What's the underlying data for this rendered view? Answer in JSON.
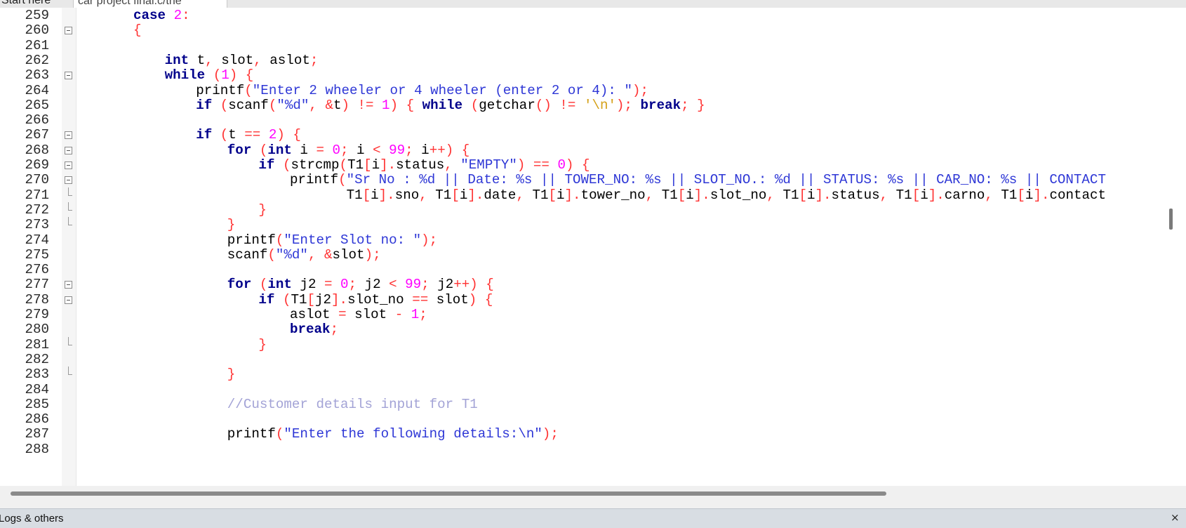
{
  "tabs": [
    {
      "label": "Start here"
    },
    {
      "label": "car project final.c/the"
    }
  ],
  "status_panel": {
    "label": "Logs & others",
    "close_glyph": "×"
  },
  "icons": {
    "fold": "fold-minus-icon",
    "close": "close-icon"
  },
  "colors": {
    "keyword": "#00008b",
    "string": "#2e37d6",
    "number": "#ff00ff",
    "operator": "#ff3333",
    "comment": "#a3a3d6",
    "char": "#d4a017"
  },
  "lines": [
    {
      "n": "259",
      "tokens": [
        {
          "t": "case",
          "c": "k"
        },
        {
          "t": " ",
          "c": "p"
        },
        {
          "t": "2",
          "c": "n"
        },
        {
          "t": ":",
          "c": "o"
        }
      ],
      "indent": 0
    },
    {
      "n": "260",
      "tokens": [
        {
          "t": "{",
          "c": "o"
        }
      ],
      "indent": 0,
      "fold": "open"
    },
    {
      "n": "261",
      "tokens": [],
      "indent": 0
    },
    {
      "n": "262",
      "tokens": [
        {
          "t": "int",
          "c": "k"
        },
        {
          "t": " t",
          "c": "p"
        },
        {
          "t": ",",
          "c": "o"
        },
        {
          "t": " slot",
          "c": "p"
        },
        {
          "t": ",",
          "c": "o"
        },
        {
          "t": " aslot",
          "c": "p"
        },
        {
          "t": ";",
          "c": "o"
        }
      ],
      "indent": 1
    },
    {
      "n": "263",
      "tokens": [
        {
          "t": "while",
          "c": "k"
        },
        {
          "t": " ",
          "c": "p"
        },
        {
          "t": "(",
          "c": "o"
        },
        {
          "t": "1",
          "c": "n"
        },
        {
          "t": ")",
          "c": "o"
        },
        {
          "t": " ",
          "c": "p"
        },
        {
          "t": "{",
          "c": "o"
        }
      ],
      "indent": 1,
      "fold": "open"
    },
    {
      "n": "264",
      "tokens": [
        {
          "t": "printf",
          "c": "p"
        },
        {
          "t": "(",
          "c": "o"
        },
        {
          "t": "\"Enter 2 wheeler or 4 wheeler (enter 2 or 4): \"",
          "c": "s"
        },
        {
          "t": ");",
          "c": "o"
        }
      ],
      "indent": 2
    },
    {
      "n": "265",
      "tokens": [
        {
          "t": "if",
          "c": "k"
        },
        {
          "t": " ",
          "c": "p"
        },
        {
          "t": "(",
          "c": "o"
        },
        {
          "t": "scanf",
          "c": "p"
        },
        {
          "t": "(",
          "c": "o"
        },
        {
          "t": "\"%d\"",
          "c": "s"
        },
        {
          "t": ",",
          "c": "o"
        },
        {
          "t": " ",
          "c": "p"
        },
        {
          "t": "&",
          "c": "o"
        },
        {
          "t": "t",
          "c": "p"
        },
        {
          "t": ")",
          "c": "o"
        },
        {
          "t": " ",
          "c": "p"
        },
        {
          "t": "!=",
          "c": "o"
        },
        {
          "t": " ",
          "c": "p"
        },
        {
          "t": "1",
          "c": "n"
        },
        {
          "t": ")",
          "c": "o"
        },
        {
          "t": " ",
          "c": "p"
        },
        {
          "t": "{",
          "c": "o"
        },
        {
          "t": " ",
          "c": "p"
        },
        {
          "t": "while",
          "c": "k"
        },
        {
          "t": " ",
          "c": "p"
        },
        {
          "t": "(",
          "c": "o"
        },
        {
          "t": "getchar",
          "c": "p"
        },
        {
          "t": "()",
          "c": "o"
        },
        {
          "t": " ",
          "c": "p"
        },
        {
          "t": "!=",
          "c": "o"
        },
        {
          "t": " ",
          "c": "p"
        },
        {
          "t": "'\\n'",
          "c": "ch"
        },
        {
          "t": ");",
          "c": "o"
        },
        {
          "t": " ",
          "c": "p"
        },
        {
          "t": "break",
          "c": "k"
        },
        {
          "t": ";",
          "c": "o"
        },
        {
          "t": " ",
          "c": "p"
        },
        {
          "t": "}",
          "c": "o"
        }
      ],
      "indent": 2
    },
    {
      "n": "266",
      "tokens": [],
      "indent": 0
    },
    {
      "n": "267",
      "tokens": [
        {
          "t": "if",
          "c": "k"
        },
        {
          "t": " ",
          "c": "p"
        },
        {
          "t": "(",
          "c": "o"
        },
        {
          "t": "t",
          "c": "p"
        },
        {
          "t": " ",
          "c": "p"
        },
        {
          "t": "==",
          "c": "o"
        },
        {
          "t": " ",
          "c": "p"
        },
        {
          "t": "2",
          "c": "n"
        },
        {
          "t": ")",
          "c": "o"
        },
        {
          "t": " ",
          "c": "p"
        },
        {
          "t": "{",
          "c": "o"
        }
      ],
      "indent": 2,
      "fold": "open"
    },
    {
      "n": "268",
      "tokens": [
        {
          "t": "for",
          "c": "k"
        },
        {
          "t": " ",
          "c": "p"
        },
        {
          "t": "(",
          "c": "o"
        },
        {
          "t": "int",
          "c": "k"
        },
        {
          "t": " i ",
          "c": "p"
        },
        {
          "t": "=",
          "c": "o"
        },
        {
          "t": " ",
          "c": "p"
        },
        {
          "t": "0",
          "c": "n"
        },
        {
          "t": ";",
          "c": "o"
        },
        {
          "t": " i ",
          "c": "p"
        },
        {
          "t": "<",
          "c": "o"
        },
        {
          "t": " ",
          "c": "p"
        },
        {
          "t": "99",
          "c": "n"
        },
        {
          "t": ";",
          "c": "o"
        },
        {
          "t": " i",
          "c": "p"
        },
        {
          "t": "++)",
          "c": "o"
        },
        {
          "t": " ",
          "c": "p"
        },
        {
          "t": "{",
          "c": "o"
        }
      ],
      "indent": 3,
      "fold": "open"
    },
    {
      "n": "269",
      "tokens": [
        {
          "t": "if",
          "c": "k"
        },
        {
          "t": " ",
          "c": "p"
        },
        {
          "t": "(",
          "c": "o"
        },
        {
          "t": "strcmp",
          "c": "p"
        },
        {
          "t": "(",
          "c": "o"
        },
        {
          "t": "T1",
          "c": "p"
        },
        {
          "t": "[",
          "c": "o"
        },
        {
          "t": "i",
          "c": "p"
        },
        {
          "t": "].",
          "c": "o"
        },
        {
          "t": "status",
          "c": "p"
        },
        {
          "t": ",",
          "c": "o"
        },
        {
          "t": " ",
          "c": "p"
        },
        {
          "t": "\"EMPTY\"",
          "c": "s"
        },
        {
          "t": ")",
          "c": "o"
        },
        {
          "t": " ",
          "c": "p"
        },
        {
          "t": "==",
          "c": "o"
        },
        {
          "t": " ",
          "c": "p"
        },
        {
          "t": "0",
          "c": "n"
        },
        {
          "t": ")",
          "c": "o"
        },
        {
          "t": " ",
          "c": "p"
        },
        {
          "t": "{",
          "c": "o"
        }
      ],
      "indent": 4,
      "fold": "open"
    },
    {
      "n": "270",
      "tokens": [
        {
          "t": "printf",
          "c": "p"
        },
        {
          "t": "(",
          "c": "o"
        },
        {
          "t": "\"Sr No : %d || Date: %s || TOWER_NO: %s || SLOT_NO.: %d || STATUS: %s || CAR_NO: %s || CONTACT",
          "c": "s"
        }
      ],
      "indent": 5,
      "fold": "open"
    },
    {
      "n": "271",
      "tokens": [
        {
          "t": "       T1",
          "c": "p"
        },
        {
          "t": "[",
          "c": "o"
        },
        {
          "t": "i",
          "c": "p"
        },
        {
          "t": "].",
          "c": "o"
        },
        {
          "t": "sno",
          "c": "p"
        },
        {
          "t": ",",
          "c": "o"
        },
        {
          "t": " T1",
          "c": "p"
        },
        {
          "t": "[",
          "c": "o"
        },
        {
          "t": "i",
          "c": "p"
        },
        {
          "t": "].",
          "c": "o"
        },
        {
          "t": "date",
          "c": "p"
        },
        {
          "t": ",",
          "c": "o"
        },
        {
          "t": " T1",
          "c": "p"
        },
        {
          "t": "[",
          "c": "o"
        },
        {
          "t": "i",
          "c": "p"
        },
        {
          "t": "].",
          "c": "o"
        },
        {
          "t": "tower_no",
          "c": "p"
        },
        {
          "t": ",",
          "c": "o"
        },
        {
          "t": " T1",
          "c": "p"
        },
        {
          "t": "[",
          "c": "o"
        },
        {
          "t": "i",
          "c": "p"
        },
        {
          "t": "].",
          "c": "o"
        },
        {
          "t": "slot_no",
          "c": "p"
        },
        {
          "t": ",",
          "c": "o"
        },
        {
          "t": " T1",
          "c": "p"
        },
        {
          "t": "[",
          "c": "o"
        },
        {
          "t": "i",
          "c": "p"
        },
        {
          "t": "].",
          "c": "o"
        },
        {
          "t": "status",
          "c": "p"
        },
        {
          "t": ",",
          "c": "o"
        },
        {
          "t": " T1",
          "c": "p"
        },
        {
          "t": "[",
          "c": "o"
        },
        {
          "t": "i",
          "c": "p"
        },
        {
          "t": "].",
          "c": "o"
        },
        {
          "t": "carno",
          "c": "p"
        },
        {
          "t": ",",
          "c": "o"
        },
        {
          "t": " T1",
          "c": "p"
        },
        {
          "t": "[",
          "c": "o"
        },
        {
          "t": "i",
          "c": "p"
        },
        {
          "t": "].",
          "c": "o"
        },
        {
          "t": "contact",
          "c": "p"
        }
      ],
      "indent": 5,
      "fold": "end"
    },
    {
      "n": "272",
      "tokens": [
        {
          "t": "}",
          "c": "o"
        }
      ],
      "indent": 4,
      "fold": "end"
    },
    {
      "n": "273",
      "tokens": [
        {
          "t": "}",
          "c": "o"
        }
      ],
      "indent": 3,
      "fold": "end"
    },
    {
      "n": "274",
      "tokens": [
        {
          "t": "printf",
          "c": "p"
        },
        {
          "t": "(",
          "c": "o"
        },
        {
          "t": "\"Enter Slot no: \"",
          "c": "s"
        },
        {
          "t": ");",
          "c": "o"
        }
      ],
      "indent": 3
    },
    {
      "n": "275",
      "tokens": [
        {
          "t": "scanf",
          "c": "p"
        },
        {
          "t": "(",
          "c": "o"
        },
        {
          "t": "\"%d\"",
          "c": "s"
        },
        {
          "t": ",",
          "c": "o"
        },
        {
          "t": " ",
          "c": "p"
        },
        {
          "t": "&",
          "c": "o"
        },
        {
          "t": "slot",
          "c": "p"
        },
        {
          "t": ");",
          "c": "o"
        }
      ],
      "indent": 3
    },
    {
      "n": "276",
      "tokens": [],
      "indent": 0
    },
    {
      "n": "277",
      "tokens": [
        {
          "t": "for",
          "c": "k"
        },
        {
          "t": " ",
          "c": "p"
        },
        {
          "t": "(",
          "c": "o"
        },
        {
          "t": "int",
          "c": "k"
        },
        {
          "t": " j2 ",
          "c": "p"
        },
        {
          "t": "=",
          "c": "o"
        },
        {
          "t": " ",
          "c": "p"
        },
        {
          "t": "0",
          "c": "n"
        },
        {
          "t": ";",
          "c": "o"
        },
        {
          "t": " j2 ",
          "c": "p"
        },
        {
          "t": "<",
          "c": "o"
        },
        {
          "t": " ",
          "c": "p"
        },
        {
          "t": "99",
          "c": "n"
        },
        {
          "t": ";",
          "c": "o"
        },
        {
          "t": " j2",
          "c": "p"
        },
        {
          "t": "++)",
          "c": "o"
        },
        {
          "t": " ",
          "c": "p"
        },
        {
          "t": "{",
          "c": "o"
        }
      ],
      "indent": 3,
      "fold": "open"
    },
    {
      "n": "278",
      "tokens": [
        {
          "t": "if",
          "c": "k"
        },
        {
          "t": " ",
          "c": "p"
        },
        {
          "t": "(",
          "c": "o"
        },
        {
          "t": "T1",
          "c": "p"
        },
        {
          "t": "[",
          "c": "o"
        },
        {
          "t": "j2",
          "c": "p"
        },
        {
          "t": "].",
          "c": "o"
        },
        {
          "t": "slot_no ",
          "c": "p"
        },
        {
          "t": "==",
          "c": "o"
        },
        {
          "t": " slot",
          "c": "p"
        },
        {
          "t": ")",
          "c": "o"
        },
        {
          "t": " ",
          "c": "p"
        },
        {
          "t": "{",
          "c": "o"
        }
      ],
      "indent": 4,
      "fold": "open"
    },
    {
      "n": "279",
      "tokens": [
        {
          "t": "aslot ",
          "c": "p"
        },
        {
          "t": "=",
          "c": "o"
        },
        {
          "t": " slot ",
          "c": "p"
        },
        {
          "t": "-",
          "c": "o"
        },
        {
          "t": " ",
          "c": "p"
        },
        {
          "t": "1",
          "c": "n"
        },
        {
          "t": ";",
          "c": "o"
        }
      ],
      "indent": 5
    },
    {
      "n": "280",
      "tokens": [
        {
          "t": "break",
          "c": "k"
        },
        {
          "t": ";",
          "c": "o"
        }
      ],
      "indent": 5
    },
    {
      "n": "281",
      "tokens": [
        {
          "t": "}",
          "c": "o"
        }
      ],
      "indent": 4,
      "fold": "end"
    },
    {
      "n": "282",
      "tokens": [],
      "indent": 0
    },
    {
      "n": "283",
      "tokens": [
        {
          "t": "}",
          "c": "o"
        }
      ],
      "indent": 3,
      "fold": "end"
    },
    {
      "n": "284",
      "tokens": [],
      "indent": 0
    },
    {
      "n": "285",
      "tokens": [
        {
          "t": "//Customer details input for T1",
          "c": "c"
        }
      ],
      "indent": 3
    },
    {
      "n": "286",
      "tokens": [],
      "indent": 0
    },
    {
      "n": "287",
      "tokens": [
        {
          "t": "printf",
          "c": "p"
        },
        {
          "t": "(",
          "c": "o"
        },
        {
          "t": "\"Enter the following details:\\n\"",
          "c": "s"
        },
        {
          "t": ");",
          "c": "o"
        }
      ],
      "indent": 3
    },
    {
      "n": "288",
      "tokens": [],
      "indent": 0
    }
  ]
}
